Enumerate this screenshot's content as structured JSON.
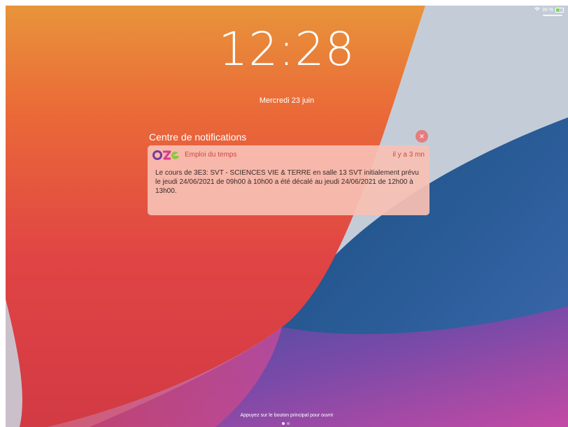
{
  "status_bar": {
    "battery_text": "39 %",
    "battery_level": 0.39
  },
  "lock_screen": {
    "time": "12:28",
    "date": "Mercredi 23 juin",
    "home_hint": "Appuyez sur le bouton principal pour ouvrir"
  },
  "notification_center": {
    "title": "Centre de notifications",
    "close_symbol": "×"
  },
  "notification": {
    "app_logo_text": "oze",
    "app_name": "Emploi du temps",
    "time_ago": "il y a 3 mn",
    "message": "Le cours de 3E3: SVT - SCIENCES VIE & TERRE en salle 13 SVT initialement prévu le jeudi 24/06/2021 de 09h00 à 10h00 a été décalé au jeudi 24/06/2021 de 12h00 à 13h00."
  },
  "icons": {
    "wifi": "wifi-icon",
    "battery": "battery-icon",
    "close": "close-icon",
    "app_logo": "oze-logo-icon"
  },
  "colors": {
    "notification_accent": "#cc4a3e",
    "notification_bg": "#f7c0b4",
    "battery_fill": "#7dd84a"
  }
}
